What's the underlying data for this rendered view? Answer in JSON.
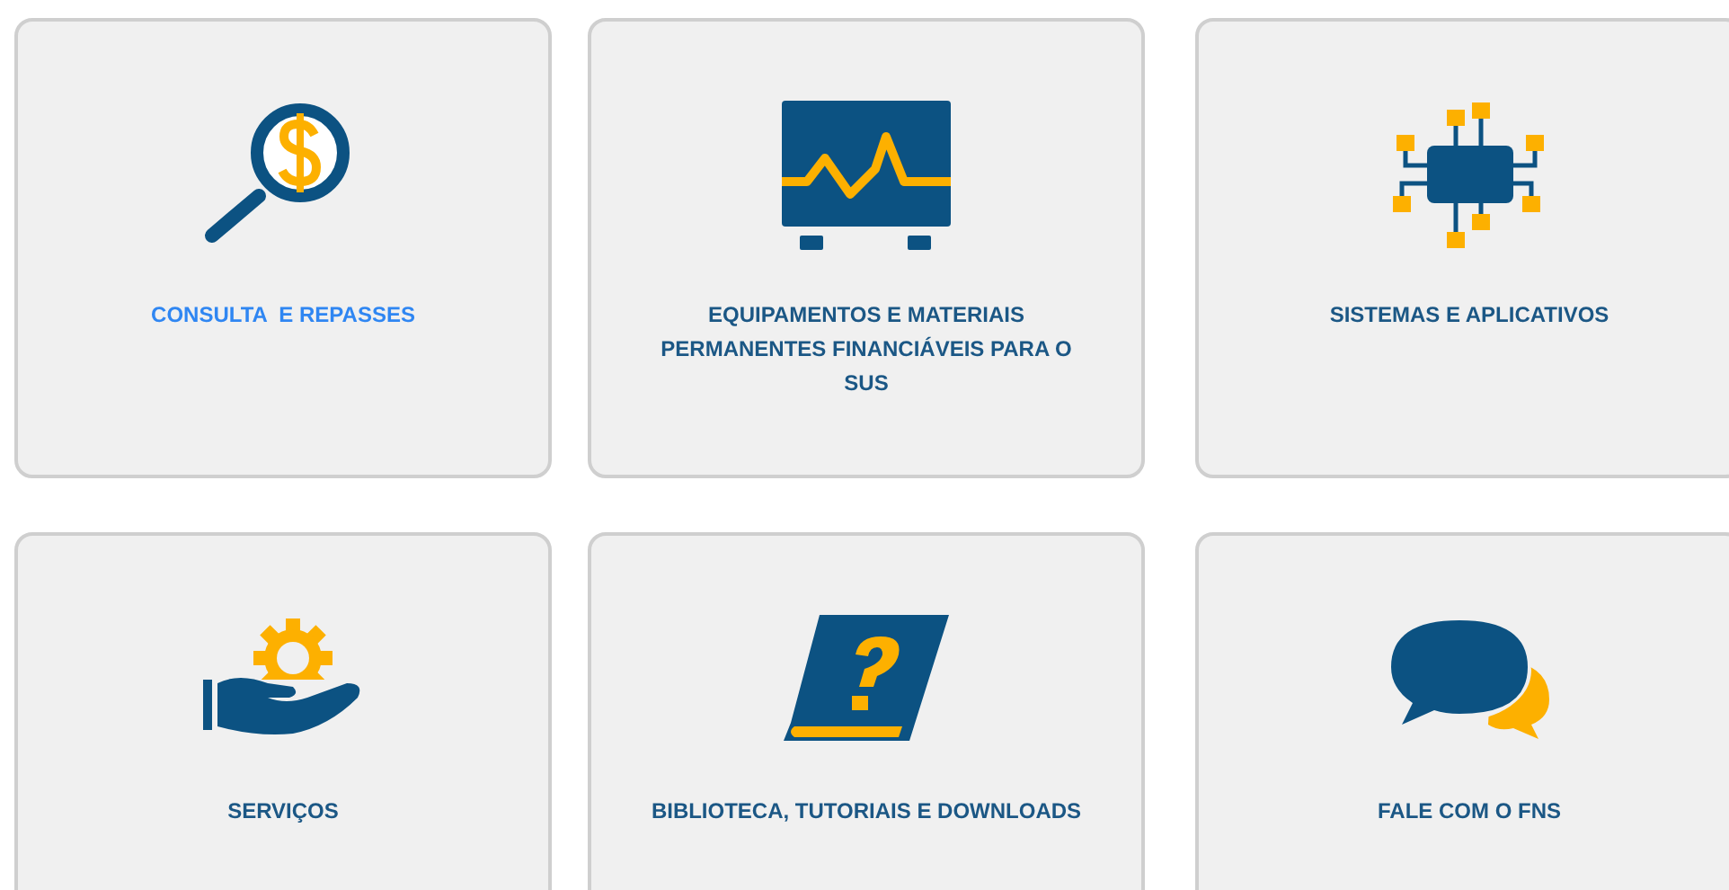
{
  "cards": [
    {
      "kind": "money-search",
      "label": "CONSULTA  E REPASSES",
      "highlighted": true
    },
    {
      "kind": "monitor",
      "label": "EQUIPAMENTOS E MATERIAIS PERMANENTES FINANCIÁVEIS PARA O SUS",
      "highlighted": false
    },
    {
      "kind": "chip",
      "label": "SISTEMAS E APLICATIVOS",
      "highlighted": false
    },
    {
      "kind": "service",
      "label": "SERVIÇOS",
      "highlighted": false
    },
    {
      "kind": "book",
      "label": "BIBLIOTECA, TUTORIAIS E DOWNLOADS",
      "highlighted": false
    },
    {
      "kind": "chat",
      "label": "FALE COM O FNS",
      "highlighted": false
    }
  ]
}
